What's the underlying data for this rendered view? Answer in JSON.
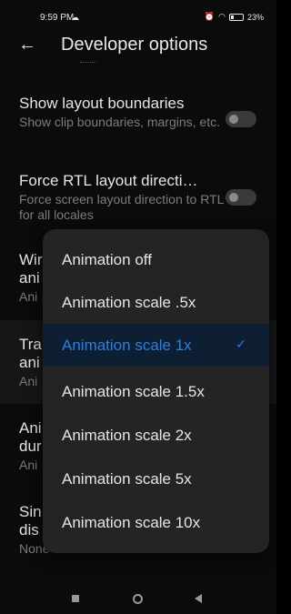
{
  "status_bar": {
    "time": "9:59 PM",
    "battery_text": "23"
  },
  "header": {
    "title": "Developer options"
  },
  "settings": [
    {
      "title": "Show layout boundaries",
      "subtitle": "Show clip boundaries, margins, etc.",
      "toggle": false
    },
    {
      "title": "Force RTL layout directi…",
      "subtitle": "Force screen layout direction to RTL for all locales",
      "toggle": false
    },
    {
      "title": "Wir",
      "title2": "ani",
      "subtitle": "Ani"
    },
    {
      "title": "Tra",
      "title2": "ani",
      "subtitle": "Ani"
    },
    {
      "title": "Ani",
      "title2": "dur",
      "subtitle": "Ani"
    },
    {
      "title": "Sin",
      "title2": "dis",
      "subtitle": "None"
    }
  ],
  "menu": {
    "items": [
      "Animation off",
      "Animation scale .5x",
      "Animation scale 1x",
      "Animation scale 1.5x",
      "Animation scale 2x",
      "Animation scale 5x",
      "Animation scale 10x"
    ],
    "selected_index": 2,
    "check": "✓"
  },
  "colors": {
    "accent": "#2d7ee3",
    "background": "#0b0b0b",
    "menu_background": "#242424"
  }
}
